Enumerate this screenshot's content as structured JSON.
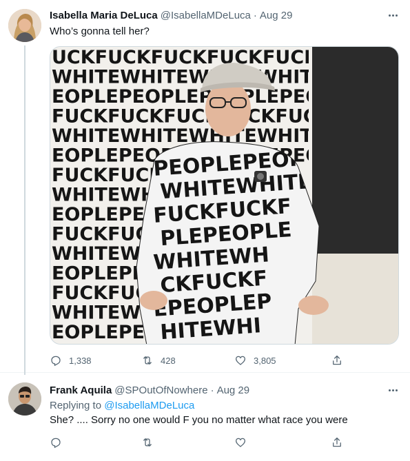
{
  "tweet": {
    "author": {
      "display_name": "Isabella Maria DeLuca",
      "handle": "@IsabellaMDeLuca",
      "date": "Aug 29"
    },
    "text": "Who’s gonna tell her?",
    "media": {
      "wall_rows": [
        "UCKFUCKFUCKFUCKFUCK",
        "WHITEWHITEWHITEWHITEW",
        "EOPLEPEOPLEPEOPLEPEOPLE",
        "FUCKFUCKFUCKFUCKFUCK",
        "WHITEWHITEWHITEWHITE",
        "EOPLEPEOPLEPEOPLEPEOPLE",
        "FUCKFUCKFUCKFUCK",
        "WHITEWHITEWHITE",
        "EOPLEPEOPLEPEO",
        "FUCKFUCKFUCK",
        "WHITEWHITEW",
        "EOPLEPEOPLEP",
        "FUCKFUCKFU",
        "WHITEWHITE",
        "EOPLEPEOPLE"
      ],
      "shirt_rows": [
        "PEOPLEPEOP",
        "WHITEWHITE",
        "FUCKFUCKF",
        "PLEPEOPLE",
        "WHITEWH",
        "CKFUCKF",
        "EPEOPLEP",
        "HITEWHI"
      ],
      "colors": {
        "wall_bg": "#f2f0ec",
        "ink": "#151515",
        "dark_wall": "#2b2b2b",
        "floor": "#e7e2d8",
        "skin": "#e3b79c",
        "cap": "#d0ccc4"
      }
    },
    "actions": {
      "reply_count": "1,338",
      "retweet_count": "428",
      "like_count": "3,805"
    }
  },
  "reply": {
    "author": {
      "display_name": "Frank Aquila",
      "handle": "@SPOutOfNowhere",
      "date": "Aug 29"
    },
    "replying_to_prefix": "Replying to ",
    "replying_to_handle": "@IsabellaMDeLuca",
    "text": "She? ....  Sorry no one would F you no matter what race you were"
  },
  "separator": "·",
  "colors": {
    "accent": "#1d9bf0",
    "secondary_text": "#536471",
    "primary_text": "#0f1419",
    "border": "#eff3f4"
  },
  "icons": [
    "more-icon",
    "reply-icon",
    "retweet-icon",
    "like-icon",
    "share-icon"
  ]
}
